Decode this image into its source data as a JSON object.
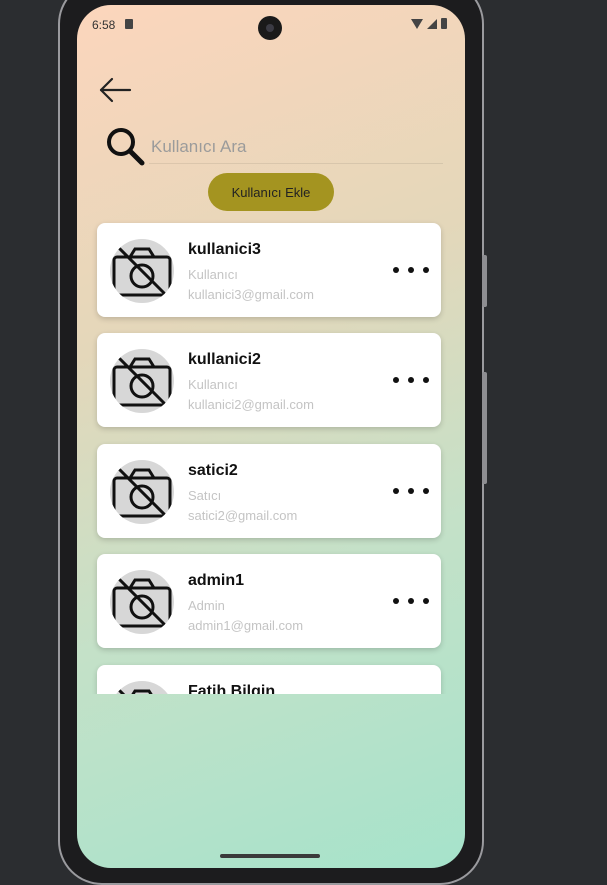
{
  "status_bar": {
    "time": "6:58"
  },
  "search": {
    "placeholder": "Kullanıcı Ara"
  },
  "actions": {
    "add_user_label": "Kullanıcı Ekle"
  },
  "users": [
    {
      "name": "kullanici3",
      "role": "Kullanıcı",
      "email": "kullanici3@gmail.com"
    },
    {
      "name": "kullanici2",
      "role": "Kullanıcı",
      "email": "kullanici2@gmail.com"
    },
    {
      "name": "satici2",
      "role": "Satıcı",
      "email": "satici2@gmail.com"
    },
    {
      "name": "admin1",
      "role": "Admin",
      "email": "admin1@gmail.com"
    },
    {
      "name": "Fatih Bilgin",
      "role": "",
      "email": ""
    }
  ],
  "colors": {
    "add_button_bg": "#a49420",
    "gradient_top": "#fcd6bc",
    "gradient_bottom": "#a6e3cb",
    "secondary_text": "#c4c4c4"
  },
  "icons": {
    "back": "arrow-left-icon",
    "search": "search-icon",
    "avatar": "no-photo-icon",
    "more": "more-horizontal-icon"
  }
}
